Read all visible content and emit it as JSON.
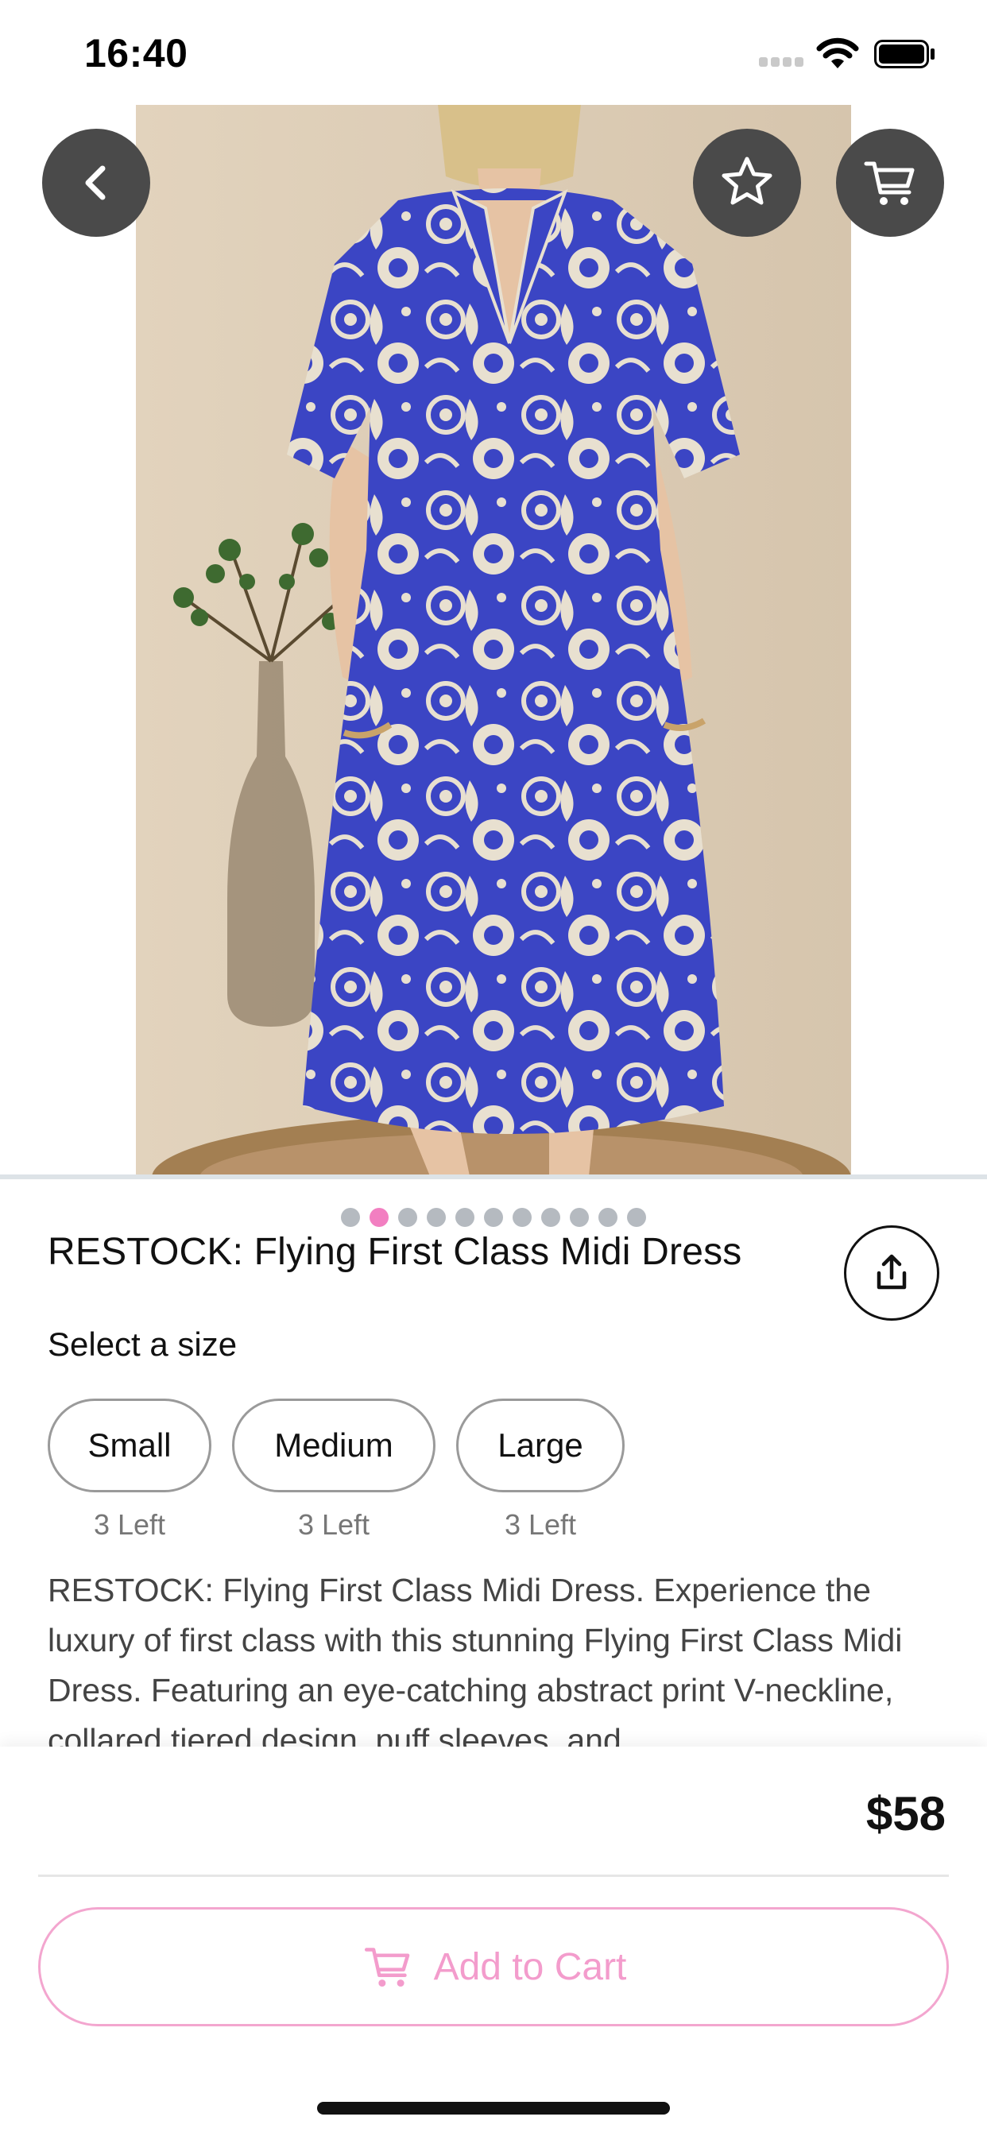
{
  "status_bar": {
    "time": "16:40"
  },
  "hero": {
    "pager_total": 11,
    "pager_active_index": 1,
    "accent": "#f27fc1"
  },
  "icons": {
    "back": "chevron-left-icon",
    "favorite": "star-icon",
    "cart": "cart-icon",
    "share": "share-icon"
  },
  "product": {
    "title": "RESTOCK: Flying First Class Midi Dress",
    "size_prompt": "Select a size",
    "sizes": [
      {
        "label": "Small",
        "stock": "3 Left"
      },
      {
        "label": "Medium",
        "stock": "3 Left"
      },
      {
        "label": "Large",
        "stock": "3 Left"
      }
    ],
    "description": "RESTOCK: Flying First Class Midi Dress. Experience the luxury of first class with this stunning Flying First Class Midi Dress. Featuring an eye-catching abstract print V-neckline, collared tiered design, puff sleeves, and"
  },
  "purchase": {
    "price": "$58",
    "add_to_cart_label": "Add to Cart",
    "button_color": "#f39ccc"
  }
}
